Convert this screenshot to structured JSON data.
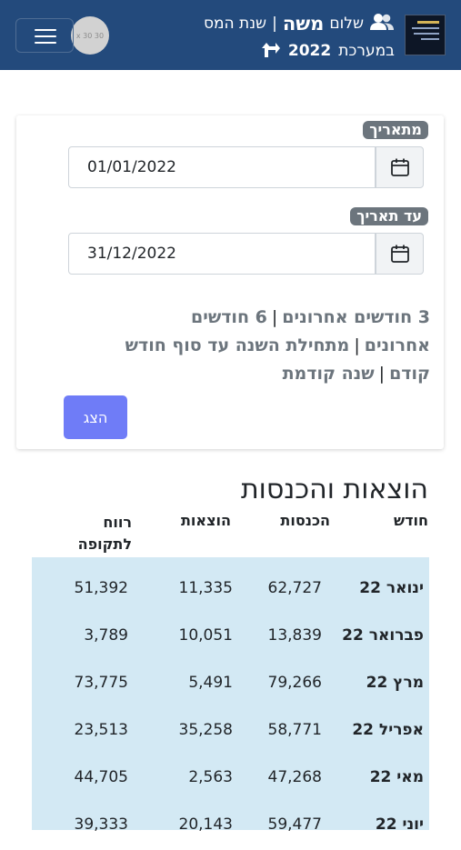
{
  "header": {
    "greeting": "שלום",
    "user_name": "משה",
    "separator": "|",
    "tax_year_label": "שנת המס",
    "in_system": "במערכת",
    "year": "2022",
    "avatar_text": "30 x 30",
    "brand_color": "#234a7c"
  },
  "filter": {
    "from_label": "מתאריך",
    "from_value": "01/01/2022",
    "to_label": "עד תאריך",
    "to_value": "31/12/2022",
    "shortcuts": [
      "3 חודשים אחרונים",
      "6 חודשים אחרונים",
      "מתחילת השנה עד סוף חודש קודם",
      "שנה קודמת"
    ],
    "shortcut_separator": "|",
    "show_button": "הצג",
    "button_color": "#6f7cf7"
  },
  "report": {
    "title": "הוצאות והכנסות",
    "columns": [
      "חודש",
      "הכנסות",
      "הוצאות",
      "רווח לתקופה"
    ],
    "rows": [
      {
        "month": "ינואר 22",
        "income": "62,727",
        "expense": "11,335",
        "profit": "51,392"
      },
      {
        "month": "פברואר 22",
        "income": "13,839",
        "expense": "10,051",
        "profit": "3,789"
      },
      {
        "month": "מרץ 22",
        "income": "79,266",
        "expense": "5,491",
        "profit": "73,775"
      },
      {
        "month": "אפריל 22",
        "income": "58,771",
        "expense": "35,258",
        "profit": "23,513"
      },
      {
        "month": "מאי 22",
        "income": "47,268",
        "expense": "2,563",
        "profit": "44,705"
      },
      {
        "month": "יוני 22",
        "income": "59,477",
        "expense": "20,143",
        "profit": "39,333"
      }
    ],
    "row_color": "#d3e9f4"
  }
}
